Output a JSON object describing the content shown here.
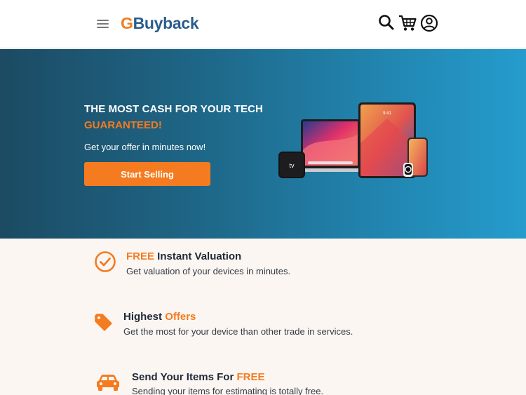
{
  "header": {
    "logo_g": "G",
    "logo_rest": "Buyback",
    "menu_icon": "hamburger-menu-icon",
    "search_icon": "search-icon",
    "cart_icon": "cart-icon",
    "account_icon": "user-account-icon"
  },
  "hero": {
    "title": "THE MOST CASH FOR YOUR TECH",
    "guarantee": "GUARANTEED!",
    "subtitle": "Get your offer in minutes now!",
    "cta_label": "Start Selling",
    "devices_image": "apple-devices-image",
    "tv_label": "tv",
    "ipad_time": "9:41"
  },
  "features": [
    {
      "icon": "checkmark-circle-icon",
      "title_highlight": "FREE",
      "title_rest": " Instant Valuation",
      "description": "Get valuation of your devices in minutes."
    },
    {
      "icon": "price-tag-icon",
      "title_plain": "Highest ",
      "title_highlight": "Offers",
      "description": "Get the most for your device than other trade in services."
    },
    {
      "icon": "car-icon",
      "title_plain": "Send Your Items For ",
      "title_highlight": "FREE",
      "description": "Sending your items for estimating is totally free."
    }
  ],
  "colors": {
    "accent": "#f47b20",
    "brand_blue": "#2b5d8c",
    "hero_gradient_start": "#1c4b63",
    "hero_gradient_end": "#259ccd",
    "page_background": "#fcf6f2"
  }
}
